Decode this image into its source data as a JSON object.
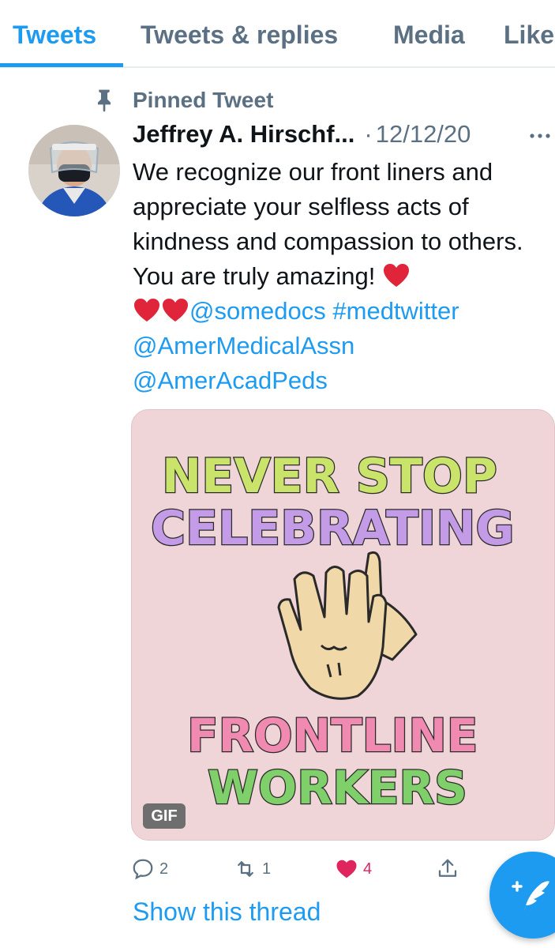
{
  "tabs": [
    {
      "label": "Tweets",
      "active": true
    },
    {
      "label": "Tweets & replies",
      "active": false
    },
    {
      "label": "Media",
      "active": false
    },
    {
      "label": "Like",
      "active": false
    }
  ],
  "pinned": {
    "label": "Pinned Tweet",
    "icon": "pin-icon"
  },
  "tweet": {
    "author": "Jeffrey A. Hirschf...",
    "separator": "·",
    "date": "12/12/20",
    "text_line1": "We recognize our front liners and appreciate your selfless acts of kindness and compassion to others. You are truly amazing!",
    "mentions": [
      "@somedocs",
      "#medtwitter",
      "@AmerMedicalAssn",
      "@AmerAcadPeds"
    ],
    "media": {
      "type": "GIF",
      "badge": "GIF",
      "headline_line1": "NEVER STOP",
      "headline_line2": "CELEBRATING",
      "footer_line1": "FRONTLINE",
      "footer_line2": "WORKERS"
    },
    "actions": {
      "reply_count": "2",
      "retweet_count": "1",
      "like_count": "4",
      "liked": true
    },
    "show_thread": "Show this thread"
  },
  "colors": {
    "accent": "#1d9bf0",
    "muted": "#5b7083",
    "like": "#e0245e",
    "media_bg": "#f0d5d8"
  }
}
